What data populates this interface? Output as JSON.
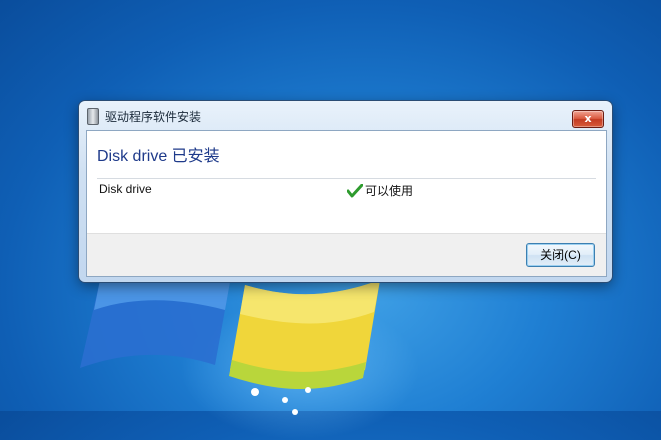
{
  "window": {
    "title": "驱动程序软件安装",
    "close_glyph": "x",
    "heading": "Disk drive 已安装",
    "rows": [
      {
        "device": "Disk drive",
        "status": "可以使用",
        "status_icon": "check-icon"
      }
    ],
    "close_button_label": "关闭(C)"
  },
  "colors": {
    "heading": "#1e3a8a",
    "check": "#2e9b2e",
    "close_button_red": "#c33b22"
  }
}
